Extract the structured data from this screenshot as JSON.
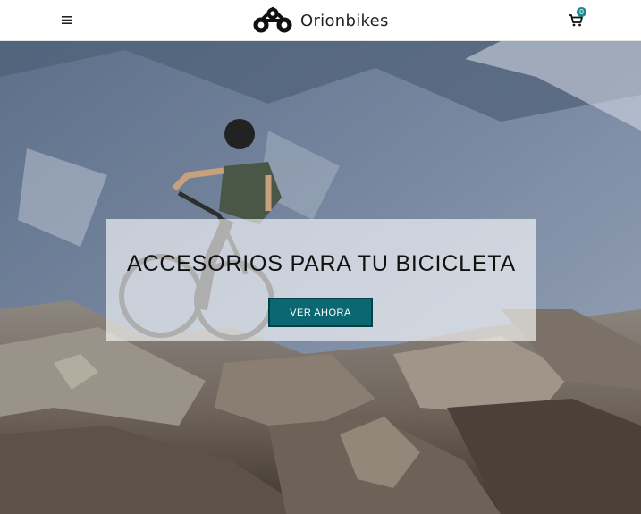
{
  "header": {
    "menu_icon": "hamburger-icon",
    "logo_text": "Orionbikes",
    "logo_icon": "bike-chain-logo",
    "cart_icon": "shopping-cart-icon",
    "cart_count": "0"
  },
  "hero": {
    "image": "mountain-biker-on-rocky-ridge",
    "title": "ACCESORIOS PARA TU BICICLETA",
    "cta_label": "VER AHORA"
  },
  "colors": {
    "accent": "#0b6772",
    "badge": "#1f8a96"
  }
}
